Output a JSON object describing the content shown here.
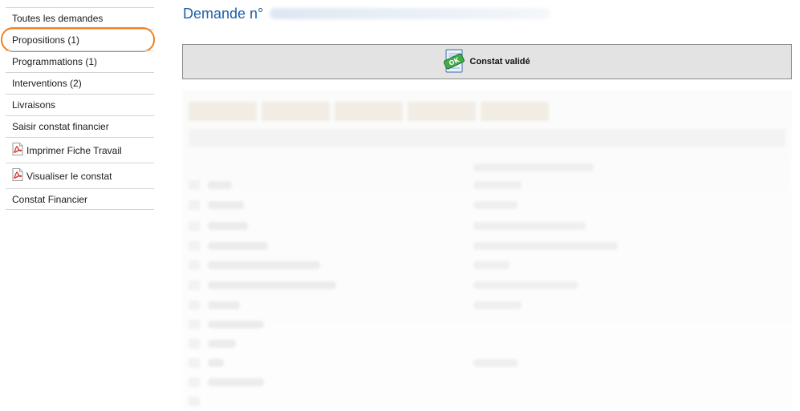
{
  "sidebar": {
    "items": [
      {
        "label": "Toutes les demandes"
      },
      {
        "label": "Propositions (1)"
      },
      {
        "label": "Programmations (1)"
      },
      {
        "label": "Interventions (2)"
      },
      {
        "label": "Livraisons"
      },
      {
        "label": "Saisir constat financier"
      },
      {
        "label": "Imprimer Fiche Travail",
        "icon": "pdf-icon"
      },
      {
        "label": "Visualiser le constat",
        "icon": "pdf-icon"
      },
      {
        "label": "Constat Financier"
      }
    ],
    "highlighted_index": 1,
    "highlight_color": "#f2811d"
  },
  "main": {
    "title_prefix": "Demande n°",
    "status": {
      "label": "Constat validé",
      "icon": "ok-stamp-icon"
    }
  },
  "colors": {
    "title": "#1f5fa8",
    "status_bg": "#e3e3e3",
    "divider": "#d4d4d4"
  }
}
